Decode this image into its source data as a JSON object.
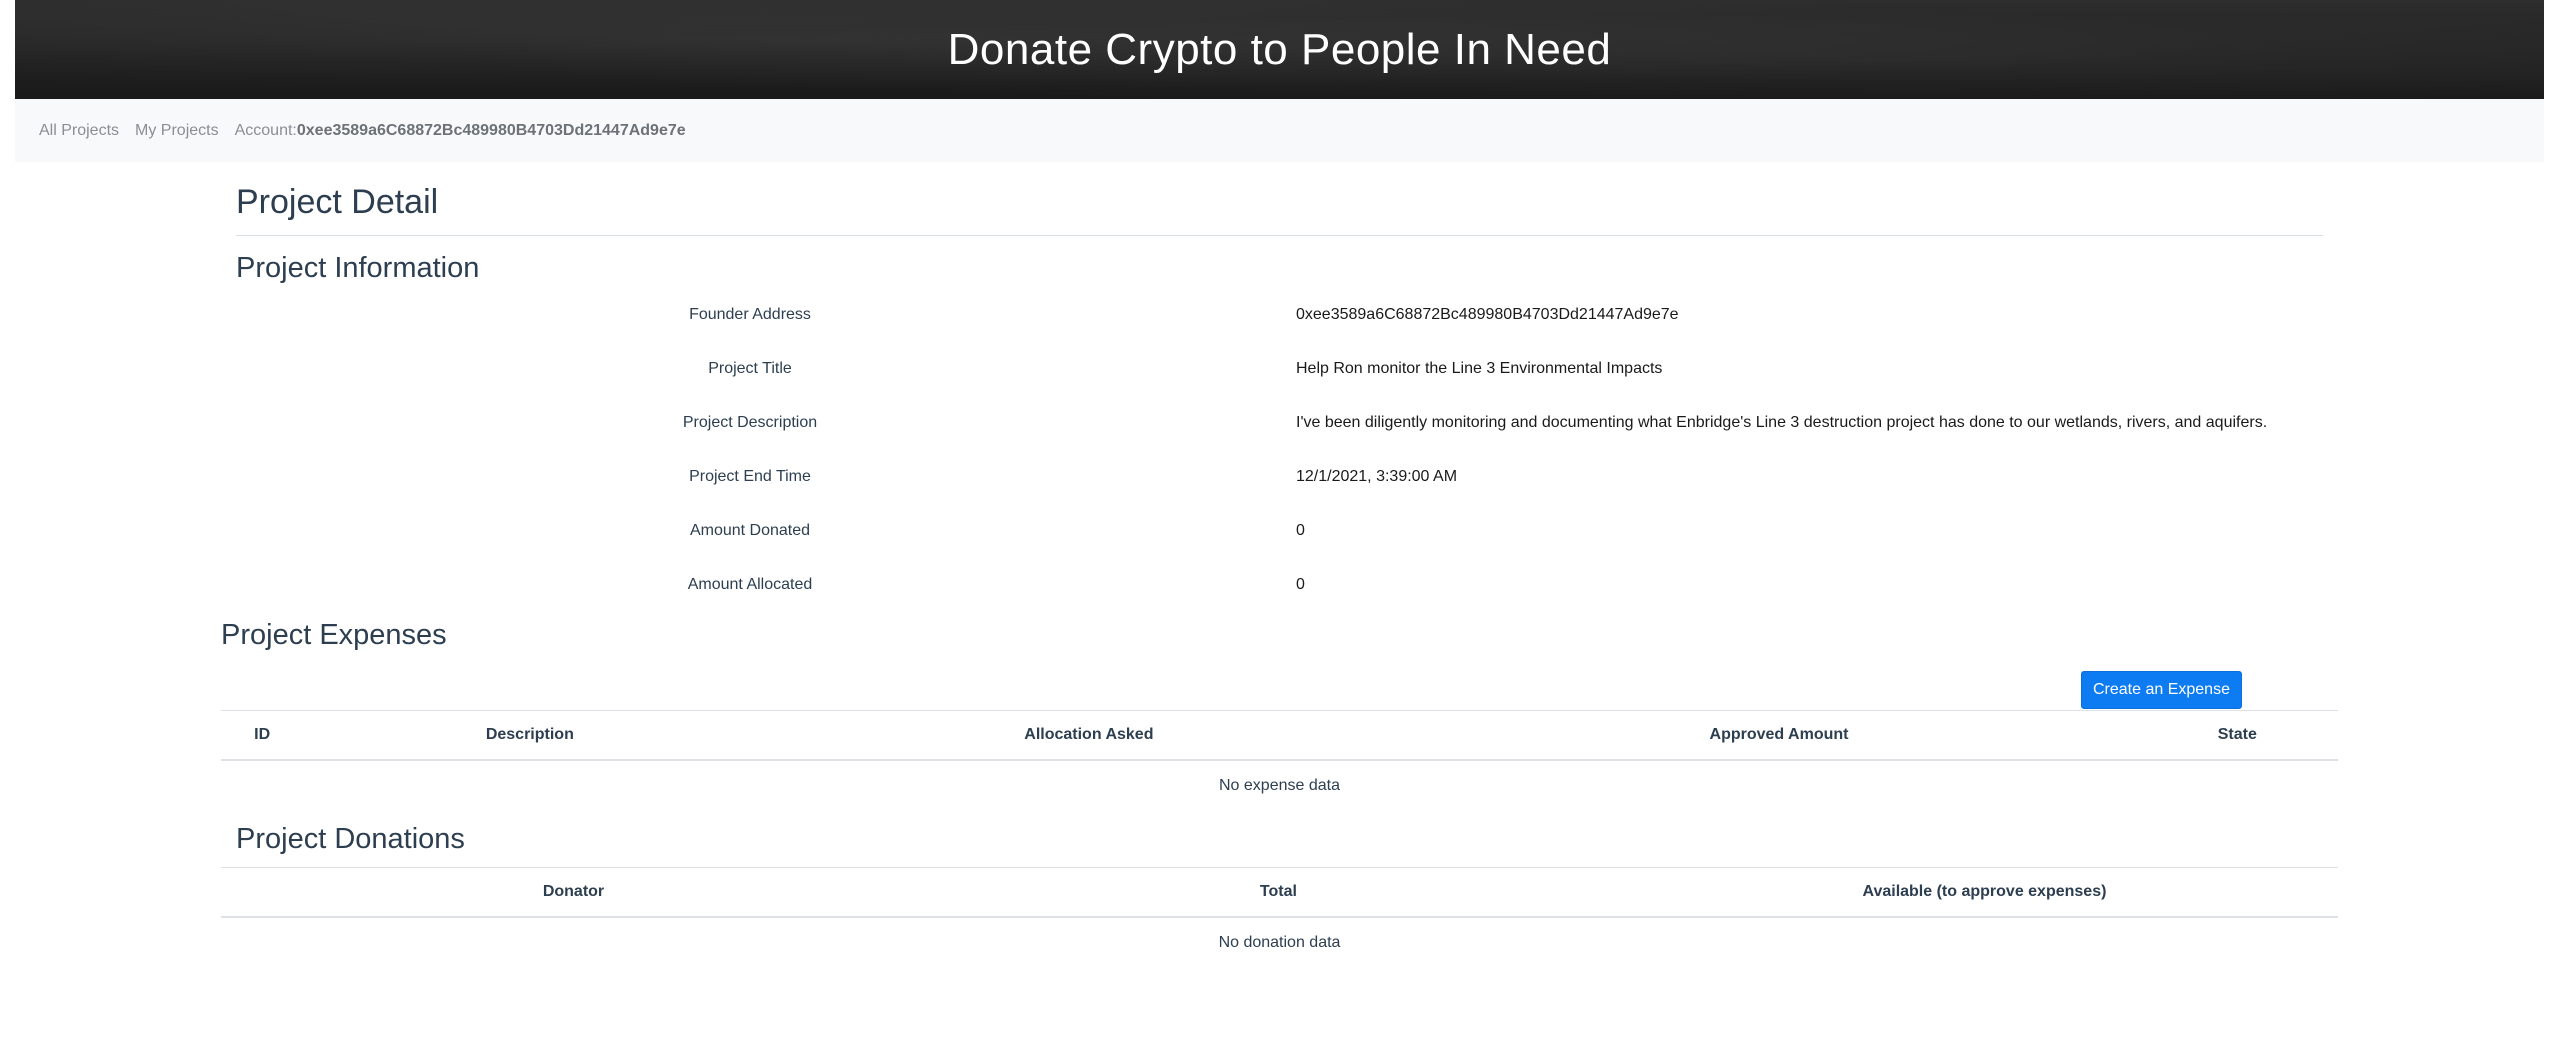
{
  "banner": {
    "title": "Donate Crypto to People In Need"
  },
  "nav": {
    "all_projects": "All Projects",
    "my_projects": "My Projects",
    "account_label": "Account:",
    "account_address": "0xee3589a6C68872Bc489980B4703Dd21447Ad9e7e"
  },
  "page": {
    "title": "Project Detail",
    "info_heading": "Project Information",
    "expenses_heading": "Project Expenses",
    "donations_heading": "Project Donations"
  },
  "info": [
    {
      "label": "Founder Address",
      "value": "0xee3589a6C68872Bc489980B4703Dd21447Ad9e7e"
    },
    {
      "label": "Project Title",
      "value": "Help Ron monitor the Line 3 Environmental Impacts"
    },
    {
      "label": "Project Description",
      "value": "I've been diligently monitoring and documenting what Enbridge's Line 3 destruction project has done to our wetlands, rivers, and aquifers."
    },
    {
      "label": "Project End Time",
      "value": "12/1/2021, 3:39:00 AM"
    },
    {
      "label": "Amount Donated",
      "value": "0"
    },
    {
      "label": "Amount Allocated",
      "value": "0"
    }
  ],
  "expenses": {
    "create_button": "Create an Expense",
    "columns": [
      "ID",
      "Description",
      "Allocation Asked",
      "Approved Amount",
      "State"
    ],
    "empty_text": "No expense data"
  },
  "donations": {
    "columns": [
      "Donator",
      "Total",
      "Available (to approve expenses)"
    ],
    "empty_text": "No donation data"
  },
  "colors": {
    "banner_bg": "#1f1f1f",
    "navbar_bg": "#f8f9fa",
    "heading_text": "#2c3e50",
    "primary_button": "#0d7bf2"
  }
}
